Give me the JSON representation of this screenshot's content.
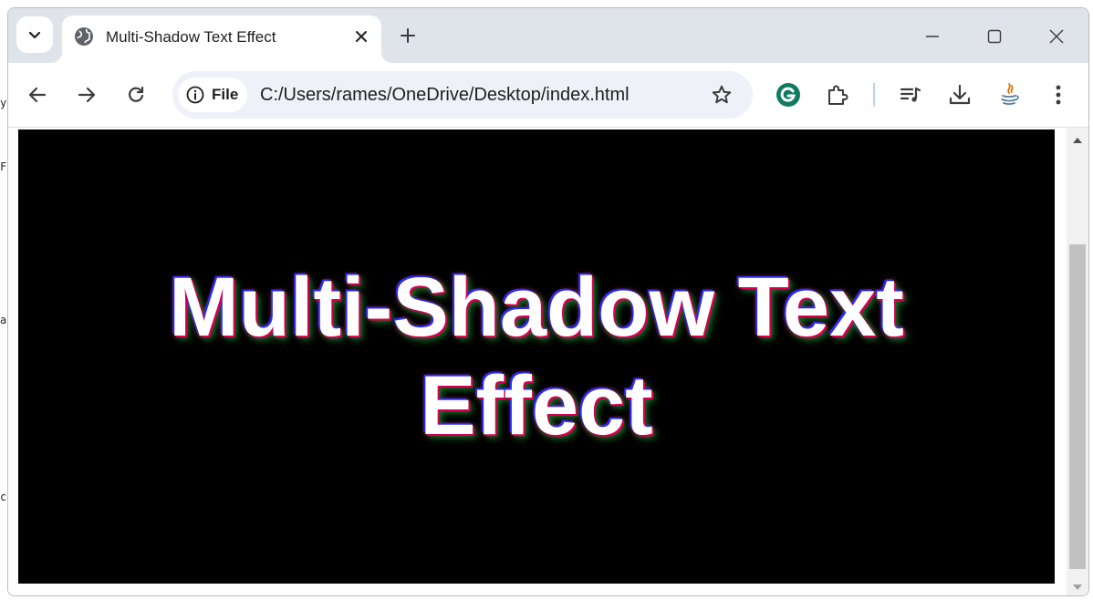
{
  "desktop_edge": {
    "chars": [
      "y",
      "F",
      "a",
      "c"
    ]
  },
  "tab": {
    "title": "Multi-Shadow Text Effect",
    "favicon": "globe-icon"
  },
  "omnibox": {
    "chip_label": "File",
    "url": "C:/Users/rames/OneDrive/Desktop/index.html"
  },
  "toolbar_icons": [
    "back-arrow-icon",
    "forward-arrow-icon",
    "reload-icon",
    "star-icon",
    "grammarly-icon",
    "extensions-puzzle-icon",
    "media-queue-icon",
    "download-icon",
    "java-icon",
    "more-vert-icon"
  ],
  "page": {
    "headline": "Multi-Shadow Text Effect",
    "background_color": "#000000",
    "text_color": "#ffffff",
    "shadow_colors": [
      "#d4004f",
      "#2a2aff",
      "#0f7a2a"
    ]
  },
  "colors": {
    "titlebar": "#dfe3ea",
    "omnibox": "#eef1f7",
    "grammarly": "#15c39a"
  }
}
